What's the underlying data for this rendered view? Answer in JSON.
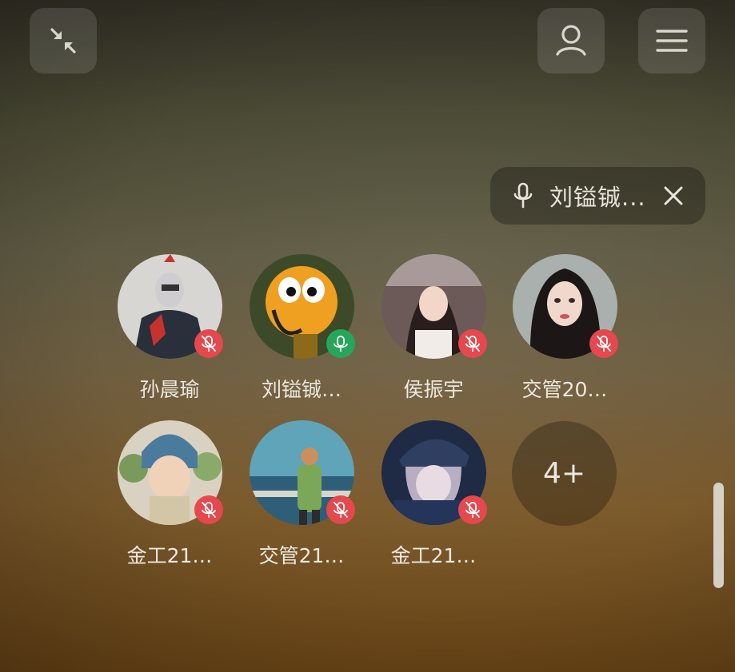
{
  "toolbar": {
    "collapse_icon": "collapse-arrows-icon",
    "profile_icon": "person-icon",
    "menu_icon": "hamburger-menu-icon"
  },
  "speaking": {
    "name": "刘镒铖...",
    "mic_icon": "microphone-icon",
    "close_icon": "close-icon"
  },
  "participants": [
    {
      "name": "孙晨瑜",
      "mic": "muted"
    },
    {
      "name": "刘镒铖…",
      "mic": "active"
    },
    {
      "name": "侯振宇",
      "mic": "muted"
    },
    {
      "name": "交管20…",
      "mic": "muted"
    },
    {
      "name": "金工21…",
      "mic": "muted"
    },
    {
      "name": "交管21…",
      "mic": "muted"
    },
    {
      "name": "金工21…",
      "mic": "muted"
    }
  ],
  "more": {
    "label": "4+"
  },
  "colors": {
    "muted_badge": "#e5484d",
    "active_badge": "#26a65b"
  }
}
